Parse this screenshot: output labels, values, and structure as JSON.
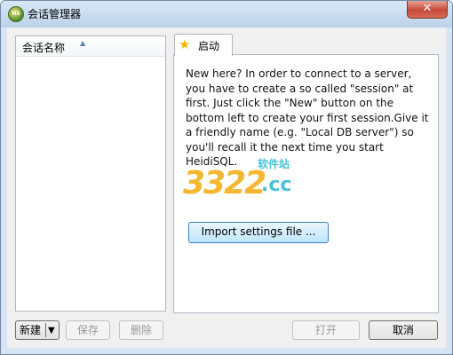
{
  "window": {
    "title": "会话管理器",
    "icon": "heidisql-app-icon",
    "close_glyph": "✕"
  },
  "session_list": {
    "column_header": "会话名称",
    "sort_glyph": "▲",
    "items": []
  },
  "tabs": [
    {
      "label": "启动",
      "icon": "star-icon",
      "glyph": "★"
    }
  ],
  "welcome_text": "New here? In order to connect to a server, you have to create a so called \"session\" at first. Just click the \"New\" button on the bottom left to create your first session.Give it a friendly name (e.g. \"Local DB server\") so you'll recall it the next time you start HeidiSQL.",
  "import_button": "Import settings file ...",
  "watermark": {
    "number": "3322",
    "domain": ".cc",
    "label": "软件站"
  },
  "buttons": {
    "new": "新建",
    "new_dropdown_glyph": "▼",
    "save": "保存",
    "delete": "删除",
    "open": "打开",
    "cancel": "取消"
  },
  "colors": {
    "accent": "#3b7fc4",
    "star": "#f2b705",
    "close": "#c5483a"
  }
}
